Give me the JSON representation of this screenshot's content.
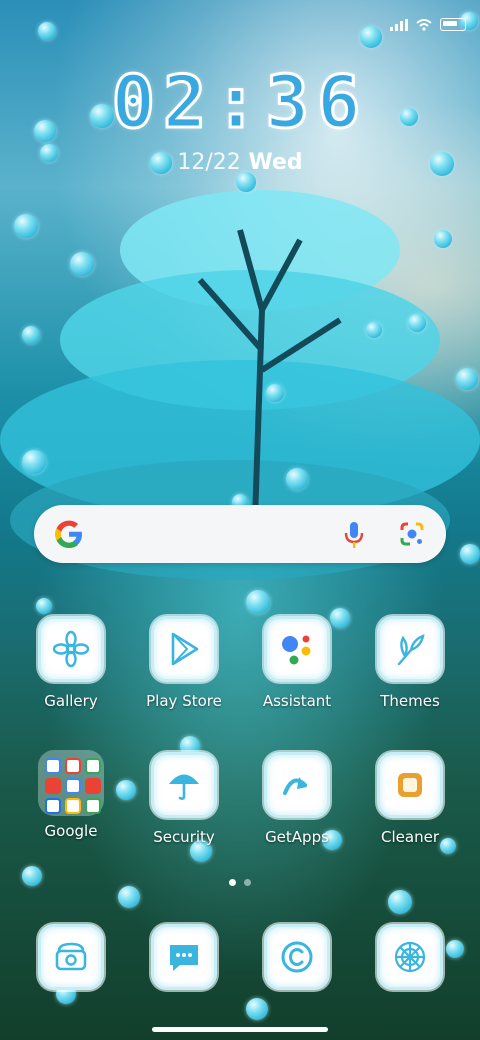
{
  "status_bar": {
    "signal_icon": "signal-icon",
    "wifi_icon": "wifi-icon",
    "battery_icon": "battery-icon"
  },
  "lock_clock": {
    "time": "02:36",
    "date": "12/22",
    "weekday": "Wed"
  },
  "search_widget": {
    "logo_icon": "google-logo-icon",
    "mic_icon": "microphone-icon",
    "lens_icon": "google-lens-icon"
  },
  "apps_row1": [
    {
      "label": "Gallery",
      "icon": "gallery-flower-icon"
    },
    {
      "label": "Play Store",
      "icon": "play-store-icon"
    },
    {
      "label": "Assistant",
      "icon": "assistant-icon"
    },
    {
      "label": "Themes",
      "icon": "themes-brush-icon"
    }
  ],
  "apps_row2": [
    {
      "label": "Google",
      "icon": "google-folder-icon"
    },
    {
      "label": "Security",
      "icon": "umbrella-icon"
    },
    {
      "label": "GetApps",
      "icon": "getapps-arrow-icon"
    },
    {
      "label": "Cleaner",
      "icon": "cleaner-icon"
    }
  ],
  "dock": [
    {
      "icon": "phone-icon"
    },
    {
      "icon": "messages-icon"
    },
    {
      "icon": "copyright-circle-icon"
    },
    {
      "icon": "browser-globe-icon"
    }
  ],
  "page_indicator": {
    "pages": 2,
    "current": 1
  },
  "colors": {
    "accent": "#3aa8e0",
    "icon_tint": "#39b5e0",
    "tile_border": "#c6eef7"
  }
}
